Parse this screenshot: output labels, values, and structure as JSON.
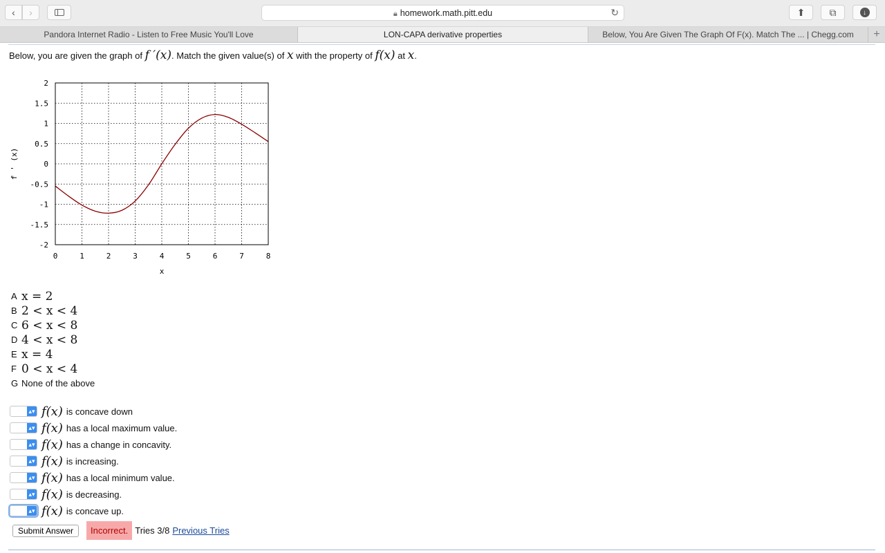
{
  "browser": {
    "url": "homework.math.pitt.edu",
    "tabs": [
      {
        "label": "Pandora Internet Radio - Listen to Free Music You'll Love",
        "active": false
      },
      {
        "label": "LON-CAPA derivative properties",
        "active": true
      },
      {
        "label": "Below, You Are Given The Graph Of F(x). Match The ... | Chegg.com",
        "active": false
      }
    ]
  },
  "question": {
    "t1": "Below, you are given the graph of",
    "fprime": "f ′(x)",
    "t2": ". Match the given value(s) of",
    "x1": "x",
    "t3": "with the property of",
    "fx": "f(x)",
    "t4": "at",
    "x2": "x",
    "t5": "."
  },
  "chart_data": {
    "type": "line",
    "xlabel": "x",
    "ylabel": "f ' (x)",
    "xlim": [
      0,
      8
    ],
    "ylim": [
      -2,
      2
    ],
    "xticks": [
      "0",
      "1",
      "2",
      "3",
      "4",
      "5",
      "6",
      "7",
      "8"
    ],
    "yticks": [
      "2",
      "1.5",
      "1",
      "0.5",
      "0",
      "-0.5",
      "-1",
      "-1.5",
      "-2"
    ],
    "grid": true,
    "series": [
      {
        "color": "#8b0000",
        "x": [
          0,
          0.5,
          1,
          1.5,
          2,
          2.5,
          3,
          3.5,
          4,
          4.5,
          5,
          5.5,
          6,
          6.5,
          7,
          7.5,
          8
        ],
        "y": [
          -0.55,
          -0.8,
          -1.02,
          -1.17,
          -1.22,
          -1.15,
          -0.92,
          -0.52,
          0,
          0.48,
          0.88,
          1.13,
          1.22,
          1.15,
          0.98,
          0.77,
          0.55
        ]
      }
    ]
  },
  "options": [
    {
      "letter": "A",
      "text": "x = 2"
    },
    {
      "letter": "B",
      "text": "2 < x < 4"
    },
    {
      "letter": "C",
      "text": "6 < x < 8"
    },
    {
      "letter": "D",
      "text": "4 < x < 8"
    },
    {
      "letter": "E",
      "text": "x = 4"
    },
    {
      "letter": "F",
      "text": "0 < x < 4"
    },
    {
      "letter": "G",
      "text": "None of the above"
    }
  ],
  "matches": [
    {
      "fx": "f(x)",
      "text": "is concave down"
    },
    {
      "fx": "f(x)",
      "text": "has a local maximum value."
    },
    {
      "fx": "f(x)",
      "text": "has a change in concavity."
    },
    {
      "fx": "f(x)",
      "text": "is increasing."
    },
    {
      "fx": "f(x)",
      "text": "has a local minimum value."
    },
    {
      "fx": "f(x)",
      "text": "is decreasing."
    },
    {
      "fx": "f(x)",
      "text": "is concave up."
    }
  ],
  "submit": {
    "label": "Submit Answer",
    "status": "Incorrect.",
    "tries": "Tries 3/8",
    "previous": "Previous Tries"
  }
}
